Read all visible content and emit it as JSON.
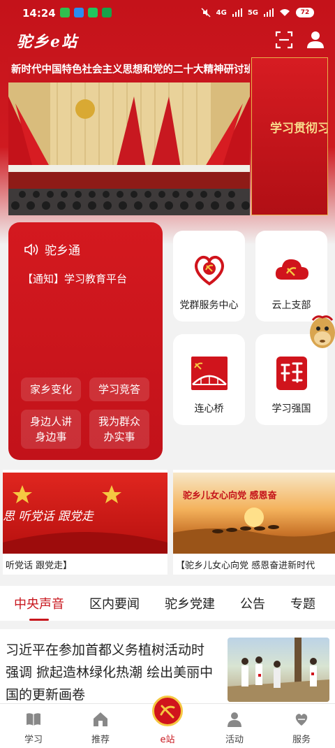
{
  "status_bar": {
    "time": "14:24",
    "signal_1": "4G",
    "signal_2": "5G",
    "battery": "72"
  },
  "app": {
    "logo": "驼乡e站"
  },
  "banner": {
    "title": "新时代中国特色社会主义思想和党的二十大精神研讨班",
    "next_title": "学习贯彻习"
  },
  "notice": {
    "heading": "驼乡通",
    "text": "【通知】学习教育平台"
  },
  "quick_buttons": [
    {
      "label": "家乡变化"
    },
    {
      "label": "学习竞答"
    },
    {
      "line1": "身边人讲",
      "line2": "身边事"
    },
    {
      "line1": "我为群众",
      "line2": "办实事"
    }
  ],
  "services": [
    {
      "label": "党群服务中心",
      "icon": "heart-party-icon"
    },
    {
      "label": "云上支部",
      "icon": "cloud-party-icon"
    },
    {
      "label": "连心桥",
      "icon": "bridge-icon"
    },
    {
      "label": "学习强国",
      "icon": "xuexi-qiangguo-icon"
    }
  ],
  "features": [
    {
      "banner_text": "思 听党话 跟党走",
      "caption": "听党话 跟党走】"
    },
    {
      "banner_text": "驼乡儿女心向党 感恩奋",
      "caption": "【驼乡儿女心向党 感恩奋进新时代"
    }
  ],
  "tabs": [
    "中央声音",
    "区内要闻",
    "驼乡党建",
    "公告",
    "专题"
  ],
  "active_tab": 0,
  "article": {
    "title": "习近平在参加首都义务植树活动时强调 掀起造林绿化热潮 绘出美丽中国的更新画卷"
  },
  "bottom_nav": [
    {
      "label": "学习",
      "icon": "book-icon"
    },
    {
      "label": "推荐",
      "icon": "home-icon"
    },
    {
      "label": "e站",
      "icon": "party-emblem-icon"
    },
    {
      "label": "活动",
      "icon": "person-icon"
    },
    {
      "label": "服务",
      "icon": "heart-hands-icon"
    }
  ],
  "colors": {
    "primary_red": "#c8161d",
    "gold": "#f5c842"
  }
}
